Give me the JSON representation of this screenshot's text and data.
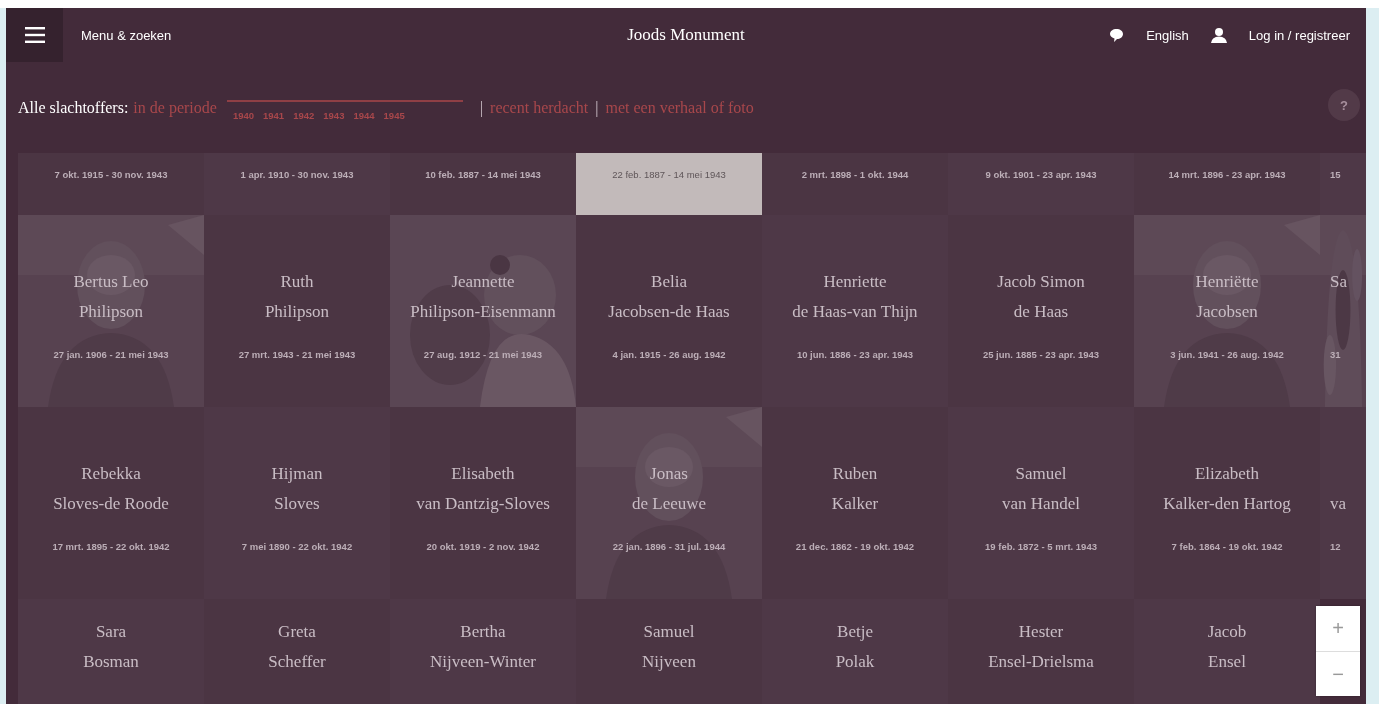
{
  "header": {
    "menu_label": "Menu & zoeken",
    "title": "Joods Monument",
    "language": "English",
    "login": "Log in / registreer"
  },
  "filter": {
    "label": "Alle slachtoffers:",
    "period_link": "in de periode",
    "level": 1,
    "years": [
      "1940",
      "1941",
      "1942",
      "1943",
      "1944",
      "1945"
    ],
    "separator_1": "|",
    "recent_link": "recent herdacht",
    "separator_2": "|",
    "story_link": "met een verhaal of foto",
    "help": "?"
  },
  "rows": [
    {
      "cells": [
        {
          "kind": "plain",
          "highlighted": false,
          "dates": "7 okt. 1915 - 30 nov. 1943"
        },
        {
          "kind": "plain",
          "highlighted": false,
          "dates": "1 apr. 1910 - 30 nov. 1943"
        },
        {
          "kind": "plain",
          "highlighted": false,
          "dates": "10 feb. 1887 - 14 mei 1943"
        },
        {
          "kind": "plain",
          "highlighted": true,
          "dates": "22 feb. 1887 - 14 mei 1943"
        },
        {
          "kind": "plain",
          "highlighted": false,
          "dates": "2 mrt. 1898 - 1 okt. 1944"
        },
        {
          "kind": "plain",
          "highlighted": false,
          "dates": "9 okt. 1901 - 23 apr. 1943"
        },
        {
          "kind": "plain",
          "highlighted": false,
          "dates": "14 mrt. 1896 - 23 apr. 1943"
        },
        {
          "kind": "plain",
          "highlighted": false,
          "dates": "15"
        }
      ]
    },
    {
      "cells": [
        {
          "kind": "picture",
          "highlighted": false,
          "first": "Bertus Leo",
          "last": "Philipson",
          "dates": "27 jan. 1906 - 21 mei 1943"
        },
        {
          "kind": "plain",
          "highlighted": false,
          "first": "Ruth",
          "last": "Philipson",
          "dates": "27 mrt. 1943 - 21 mei 1943"
        },
        {
          "kind": "picture",
          "highlighted": false,
          "first": "Jeannette",
          "last": "Philipson-Eisenmann",
          "dates": "27 aug. 1912 - 21 mei 1943"
        },
        {
          "kind": "plain",
          "highlighted": false,
          "first": "Belia",
          "last": "Jacobsen-de Haas",
          "dates": "4 jan. 1915 - 26 aug. 1942"
        },
        {
          "kind": "plain",
          "highlighted": false,
          "first": "Henriette",
          "last": "de Haas-van Thijn",
          "dates": "10 jun. 1886 - 23 apr. 1943"
        },
        {
          "kind": "plain",
          "highlighted": false,
          "first": "Jacob Simon",
          "last": "de Haas",
          "dates": "25 jun. 1885 - 23 apr. 1943"
        },
        {
          "kind": "picture",
          "highlighted": false,
          "first": "Henriëtte",
          "last": "Jacobsen",
          "dates": "3 jun. 1941 - 26 aug. 1942"
        },
        {
          "kind": "picture",
          "highlighted": false,
          "first": "Sa",
          "dates": "31"
        }
      ]
    },
    {
      "cells": [
        {
          "kind": "plain",
          "highlighted": false,
          "first": "Rebekka",
          "last": "Sloves-de Roode",
          "dates": "17 mrt. 1895 - 22 okt. 1942"
        },
        {
          "kind": "plain",
          "highlighted": false,
          "first": "Hijman",
          "last": "Sloves",
          "dates": "7 mei 1890 - 22 okt. 1942"
        },
        {
          "kind": "plain",
          "highlighted": false,
          "first": "Elisabeth",
          "last": "van Dantzig-Sloves",
          "dates": "20 okt. 1919 - 2 nov. 1942"
        },
        {
          "kind": "picture",
          "highlighted": false,
          "first": "Jonas",
          "last": "de Leeuwe",
          "dates": "22 jan. 1896 - 31 jul. 1944"
        },
        {
          "kind": "plain",
          "highlighted": false,
          "first": "Ruben",
          "last": "Kalker",
          "dates": "21 dec. 1862 - 19 okt. 1942"
        },
        {
          "kind": "plain",
          "highlighted": false,
          "first": "Samuel",
          "last": "van Handel",
          "dates": "19 feb. 1872 - 5 mrt. 1943"
        },
        {
          "kind": "plain",
          "highlighted": false,
          "first": "Elizabeth",
          "last": "Kalker-den Hartog",
          "dates": "7 feb. 1864 - 19 okt. 1942"
        },
        {
          "kind": "plain",
          "highlighted": false,
          "last": "va",
          "dates": "12"
        }
      ]
    },
    {
      "cells": [
        {
          "kind": "plain",
          "highlighted": false,
          "first": "Sara",
          "last": "Bosman"
        },
        {
          "kind": "plain",
          "highlighted": false,
          "first": "Greta",
          "last": "Scheffer"
        },
        {
          "kind": "plain",
          "highlighted": false,
          "first": "Bertha",
          "last": "Nijveen-Winter"
        },
        {
          "kind": "plain",
          "highlighted": false,
          "first": "Samuel",
          "last": "Nijveen"
        },
        {
          "kind": "plain",
          "highlighted": false,
          "first": "Betje",
          "last": "Polak"
        },
        {
          "kind": "plain",
          "highlighted": false,
          "first": "Hester",
          "last": "Ensel-Drielsma"
        },
        {
          "kind": "plain",
          "highlighted": false,
          "first": "Jacob",
          "last": "Ensel"
        }
      ]
    }
  ],
  "zoom": {
    "in": "+",
    "out": "−"
  }
}
